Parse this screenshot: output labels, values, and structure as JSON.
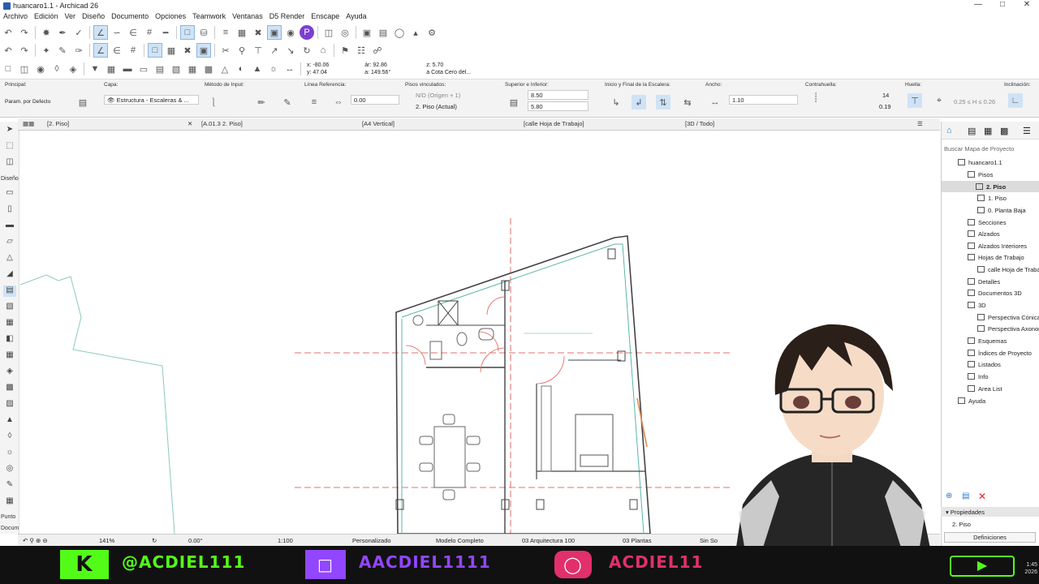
{
  "window": {
    "title": "huancaro1.1 - Archicad 26"
  },
  "menu": [
    "Archivo",
    "Edición",
    "Ver",
    "Diseño",
    "Documento",
    "Opciones",
    "Teamwork",
    "Ventanas",
    "D5 Render",
    "Enscape",
    "Ayuda"
  ],
  "coords": {
    "x": "x: -80.06",
    "y": "y: 47.04",
    "ar": "ár: 92.86",
    "a": "a: 149.56°",
    "z": "z: 5.70",
    "zref": "a Cota Cero del..."
  },
  "infobox": {
    "principal_label": "Principal:",
    "principal_value": "Param. por Defecto",
    "capa_label": "Capa:",
    "capa_value": "Estructura - Escaleras & ...",
    "metodo_label": "Método de Input:",
    "linea_label": "Línea Referencia:",
    "linea_value": "0.00",
    "pisos_label": "Pisos vinculados:",
    "pisos_top": "N/D (Origen + 1)",
    "pisos_bottom": "2. Piso (Actual)",
    "superior_label": "Superior e Inferior:",
    "superior_top": "8.50",
    "superior_bottom": "5.80",
    "inicio_label": "Inicio y Final de la Escalera:",
    "ancho_label": "Ancho:",
    "ancho_value": "1.10",
    "contrahuella_label": "Contrahuella:",
    "contrahuella_count": "14",
    "contrahuella_value": "0.19",
    "huella_label": "Huella:",
    "huella_range": "0.25 ≤ H ≤ 0.26",
    "inclinacion_label": "Inclinación:"
  },
  "tabs": [
    "[2. Piso]",
    "[A.01.3 2. Piso]",
    "[A4 Vertical]",
    "[calle Hoja de Trabajo]",
    "[3D / Todo]"
  ],
  "left_tools": {
    "diseno": "Diseño",
    "punto": "Punto",
    "docu": "Docum"
  },
  "statusbar": {
    "zoom": "141%",
    "angle": "0.00°",
    "scale": "1:100",
    "pen": "Personalizado",
    "model": "Modelo Completo",
    "layer": "03 Arquitectura 100",
    "plantas": "03 Plantas",
    "sin": "Sin So"
  },
  "navigator": {
    "search": "Buscar Mapa de Proyecto",
    "items": [
      {
        "label": "huancaro1.1",
        "level": 0
      },
      {
        "label": "Pisos",
        "level": 1
      },
      {
        "label": "2. Piso",
        "level": 2
      },
      {
        "label": "1. Piso",
        "level": 2
      },
      {
        "label": "0. Planta Baja",
        "level": 2
      },
      {
        "label": "Secciones",
        "level": 1
      },
      {
        "label": "Alzados",
        "level": 1
      },
      {
        "label": "Alzados Interiores",
        "level": 1
      },
      {
        "label": "Hojas de Trabajo",
        "level": 1
      },
      {
        "label": "calle Hoja de Trabajo (I",
        "level": 2
      },
      {
        "label": "Detalles",
        "level": 1
      },
      {
        "label": "Documentos 3D",
        "level": 1
      },
      {
        "label": "3D",
        "level": 1
      },
      {
        "label": "Perspectiva Cónica",
        "level": 2
      },
      {
        "label": "Perspectiva Axonométr",
        "level": 2
      },
      {
        "label": "Esquemas",
        "level": 1
      },
      {
        "label": "Índices de Proyecto",
        "level": 1
      },
      {
        "label": "Listados",
        "level": 1
      },
      {
        "label": "Info",
        "level": 1
      },
      {
        "label": "Area List",
        "level": 1
      },
      {
        "label": "Ayuda",
        "level": 0
      }
    ]
  },
  "properties": {
    "title": "Propiedades",
    "value": "2. Piso",
    "button": "Definiciones"
  },
  "banner": {
    "kick": "@ACDIEL111",
    "twitch": "AACDIEL1111",
    "insta": "ACDIEL11"
  },
  "clock": {
    "time": "1:45",
    "year": "2026"
  },
  "colors": {
    "accent": "#2a5da8",
    "kick": "#53fc18",
    "twitch": "#9146ff",
    "insta": "#e1306c"
  }
}
